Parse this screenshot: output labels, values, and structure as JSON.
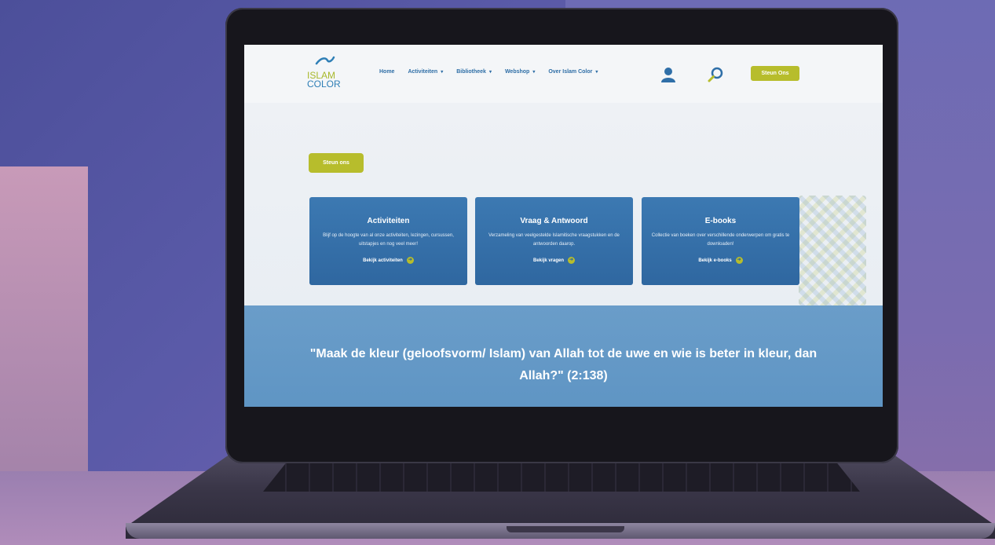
{
  "colors": {
    "accent": "#b7bd2c",
    "primary": "#2f6fa8",
    "quote_band": "#6a9dc9"
  },
  "logo": {
    "line1": "ISLAM",
    "line2": "COLOR"
  },
  "nav": {
    "items": [
      {
        "label": "Home",
        "has_dropdown": false
      },
      {
        "label": "Activiteiten",
        "has_dropdown": true
      },
      {
        "label": "Bibliotheek",
        "has_dropdown": true
      },
      {
        "label": "Webshop",
        "has_dropdown": true
      },
      {
        "label": "Over Islam Color",
        "has_dropdown": true
      }
    ],
    "icons": [
      "user-icon",
      "search-icon"
    ],
    "cta_label": "Steun Ons"
  },
  "hero": {
    "cta_label": "Steun ons"
  },
  "cards": [
    {
      "title": "Activiteiten",
      "description": "Blijf op de hoogte van al onze activiteiten, lezingen, cursussen, uitstapjes en nog veel meer!",
      "link": "Bekijk activiteiten"
    },
    {
      "title": "Vraag & Antwoord",
      "description": "Verzameling van veelgestelde Islamitische vraagstukken en de antwoorden daarop.",
      "link": "Bekijk vragen"
    },
    {
      "title": "E-books",
      "description": "Collectie van boeken over verschillende onderwerpen om gratis te downloaden!",
      "link": "Bekijk e-books"
    }
  ],
  "quote": {
    "text": "\"Maak de kleur (geloofsvorm/ Islam) van Allah tot de uwe en wie is beter in kleur, dan Allah?\" (2:138)"
  }
}
